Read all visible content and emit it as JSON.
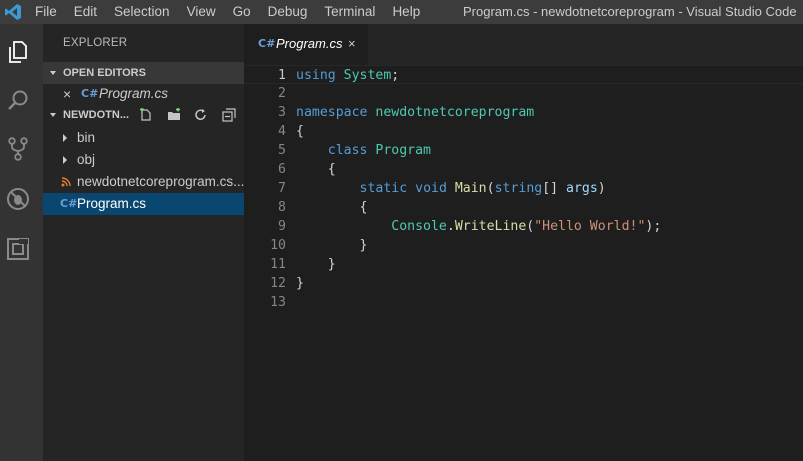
{
  "window": {
    "title": "Program.cs - newdotnetcoreprogram - Visual Studio Code"
  },
  "menu": [
    "File",
    "Edit",
    "Selection",
    "View",
    "Go",
    "Debug",
    "Terminal",
    "Help"
  ],
  "activity_bar": [
    "files-icon",
    "search-icon",
    "source-control-icon",
    "debug-icon",
    "extensions-icon"
  ],
  "explorer": {
    "title": "EXPLORER",
    "open_editors": {
      "label": "OPEN EDITORS",
      "items": [
        {
          "close": "×",
          "icon": "C#",
          "name": "Program.cs"
        }
      ]
    },
    "folder": {
      "label": "NEWDOTN...",
      "tools": [
        "new-file-icon",
        "new-folder-icon",
        "refresh-icon",
        "collapse-all-icon"
      ],
      "items": [
        {
          "name": "bin",
          "type": "folder"
        },
        {
          "name": "obj",
          "type": "folder"
        },
        {
          "name": "newdotnetcoreprogram.cs...",
          "type": "rss"
        },
        {
          "name": "Program.cs",
          "type": "csharp",
          "selected": true
        }
      ]
    }
  },
  "tab": {
    "icon": "C#",
    "label": "Program.cs",
    "close": "×"
  },
  "code_lines": [
    {
      "n": "1",
      "tokens": [
        {
          "t": "using",
          "c": "kw"
        },
        {
          "t": " ",
          "c": "pl"
        },
        {
          "t": "System",
          "c": "ty"
        },
        {
          "t": ";",
          "c": "pl"
        }
      ]
    },
    {
      "n": "2",
      "tokens": []
    },
    {
      "n": "3",
      "tokens": [
        {
          "t": "namespace",
          "c": "kw"
        },
        {
          "t": " ",
          "c": "pl"
        },
        {
          "t": "newdotnetcoreprogram",
          "c": "ty"
        }
      ]
    },
    {
      "n": "4",
      "tokens": [
        {
          "t": "{",
          "c": "pl"
        }
      ]
    },
    {
      "n": "5",
      "tokens": [
        {
          "t": "    ",
          "c": "pl"
        },
        {
          "t": "class",
          "c": "kw"
        },
        {
          "t": " ",
          "c": "pl"
        },
        {
          "t": "Program",
          "c": "ty"
        }
      ]
    },
    {
      "n": "6",
      "tokens": [
        {
          "t": "    {",
          "c": "pl"
        }
      ]
    },
    {
      "n": "7",
      "tokens": [
        {
          "t": "        ",
          "c": "pl"
        },
        {
          "t": "static",
          "c": "kw"
        },
        {
          "t": " ",
          "c": "pl"
        },
        {
          "t": "void",
          "c": "kw"
        },
        {
          "t": " ",
          "c": "pl"
        },
        {
          "t": "Main",
          "c": "fn"
        },
        {
          "t": "(",
          "c": "pl"
        },
        {
          "t": "string",
          "c": "kw"
        },
        {
          "t": "[] ",
          "c": "pl"
        },
        {
          "t": "args",
          "c": "par"
        },
        {
          "t": ")",
          "c": "pl"
        }
      ]
    },
    {
      "n": "8",
      "tokens": [
        {
          "t": "        {",
          "c": "pl"
        }
      ]
    },
    {
      "n": "9",
      "tokens": [
        {
          "t": "            ",
          "c": "pl"
        },
        {
          "t": "Console",
          "c": "ty"
        },
        {
          "t": ".",
          "c": "pl"
        },
        {
          "t": "WriteLine",
          "c": "fn"
        },
        {
          "t": "(",
          "c": "pl"
        },
        {
          "t": "\"Hello World!\"",
          "c": "str"
        },
        {
          "t": ");",
          "c": "pl"
        }
      ]
    },
    {
      "n": "10",
      "tokens": [
        {
          "t": "        }",
          "c": "pl"
        }
      ]
    },
    {
      "n": "11",
      "tokens": [
        {
          "t": "    }",
          "c": "pl"
        }
      ]
    },
    {
      "n": "12",
      "tokens": [
        {
          "t": "}",
          "c": "pl"
        }
      ]
    },
    {
      "n": "13",
      "tokens": []
    }
  ],
  "current_line": "1",
  "colors": {
    "accent": "#094771",
    "keyword": "#569cd6",
    "type": "#4ec9b0",
    "function": "#dcdcaa",
    "string": "#ce9178"
  }
}
